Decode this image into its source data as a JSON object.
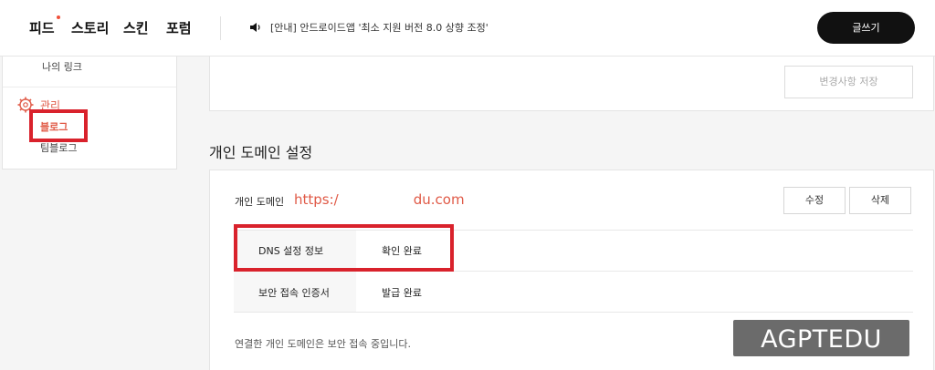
{
  "header": {
    "nav": [
      "피드",
      "스토리",
      "스킨",
      "포럼"
    ],
    "notice": "[안내] 안드로이드앱 '최소 지원 버전 8.0 상향 조정'",
    "write_label": "글쓰기",
    "accent": "#f0503a"
  },
  "sidebar": {
    "my_link": "나의 링크",
    "manage": "관리",
    "blog": "블로그",
    "team_blog": "팀블로그"
  },
  "top_panel": {
    "save_label": "변경사항 저장"
  },
  "domain_section": {
    "title": "개인 도메인 설정",
    "domain_label": "개인 도메인",
    "url_prefix": "https:/",
    "url_suffix": "du.com",
    "edit_label": "수정",
    "delete_label": "삭제",
    "rows": [
      {
        "label": "DNS 설정 정보",
        "value": "확인 완료"
      },
      {
        "label": "보안 접속 인증서",
        "value": "발급 완료"
      }
    ],
    "footer_note": "연결한 개인 도메인은 보안 접속 중입니다."
  },
  "watermark": "AGPTEDU",
  "colors": {
    "highlight": "#d9222c",
    "url": "#e05a47"
  }
}
